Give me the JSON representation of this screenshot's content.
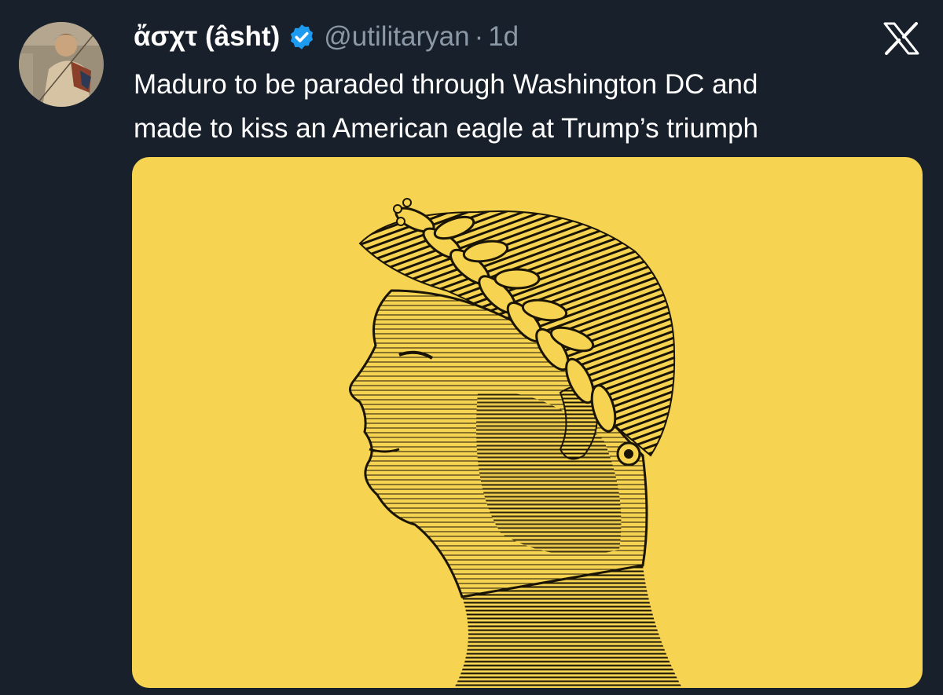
{
  "author": {
    "display_name": "ἄσχτ (âsht)",
    "handle": "@utilitaryan",
    "separator": "·",
    "time": "1d",
    "verified": true,
    "verified_icon": "verified-badge-icon",
    "avatar_icon": "mosaic-portrait-avatar"
  },
  "platform": {
    "logo_icon": "x-logo-icon"
  },
  "tweet": {
    "text_lines": [
      "Maduro to be paraded through Washington DC and",
      "made to kiss an American eagle at Trump’s triumph"
    ]
  },
  "media": {
    "icon": "engraved-profile-laurel-wreath-illustration",
    "background_color": "#f6d452"
  },
  "colors": {
    "background": "#18202b",
    "verified": "#1d9bf0",
    "secondary_text": "#8b98a5"
  }
}
